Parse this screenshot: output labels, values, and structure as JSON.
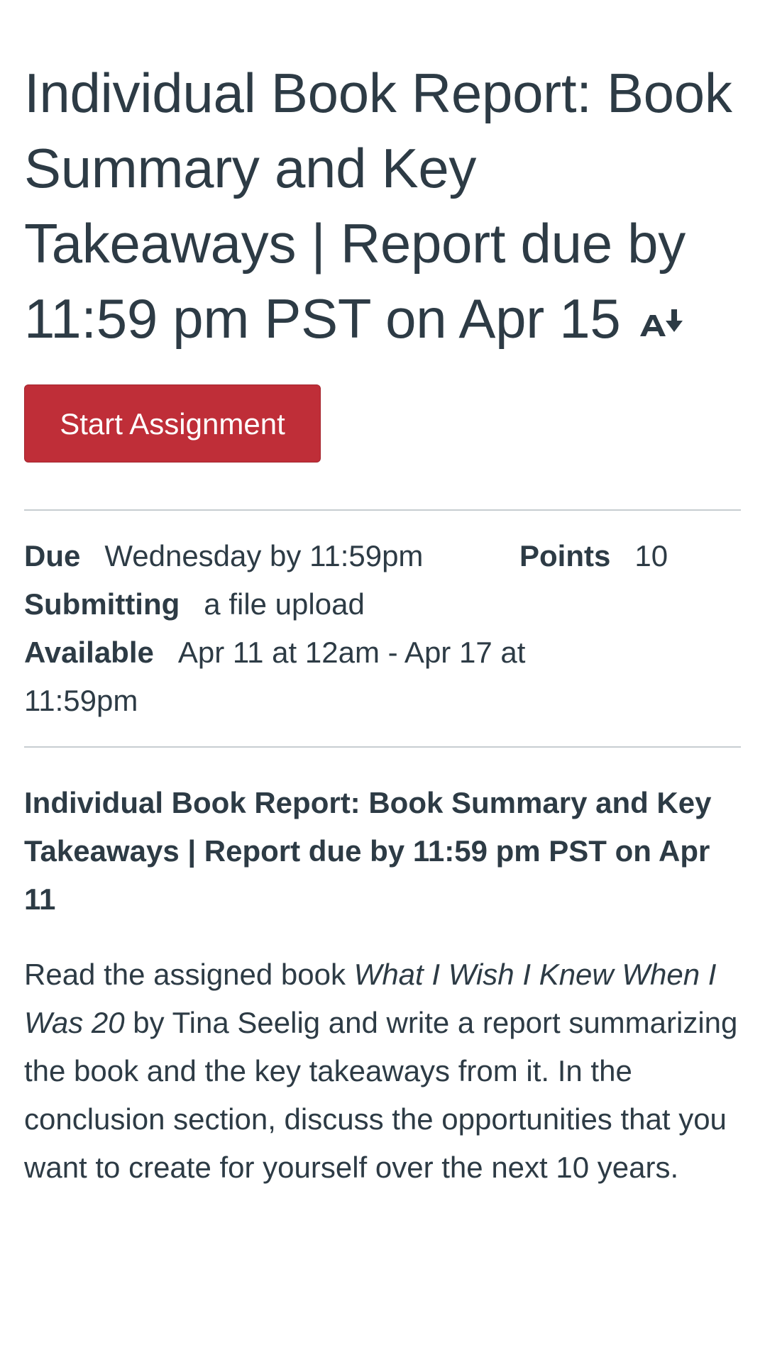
{
  "assignment": {
    "title": "Individual Book Report: Book Summary and Key Takeaways  | Report due by 11:59 pm PST on Apr 15",
    "title_icon": "immersive-reader-icon",
    "start_button_label": "Start Assignment",
    "accent_color": "#bf2e38"
  },
  "details": {
    "due_label": "Due",
    "due_value": "Wednesday by 11:59pm",
    "points_label": "Points",
    "points_value": "10",
    "submitting_label": "Submitting",
    "submitting_value": "a file upload",
    "available_label": "Available",
    "available_value": "Apr 11 at 12am - Apr 17 at 11:59pm"
  },
  "description": {
    "heading": "Individual Book Report: Book Summary and Key Takeaways  | Report due by 11:59 pm PST on Apr 11",
    "body_before": "Read the assigned book ",
    "book_title": "What I Wish I Knew When I Was 20",
    "body_after": " by Tina Seelig and write a report summarizing the book and the key takeaways from it. In the conclusion section, discuss the opportunities that you want to create for yourself over the next 10 years."
  }
}
